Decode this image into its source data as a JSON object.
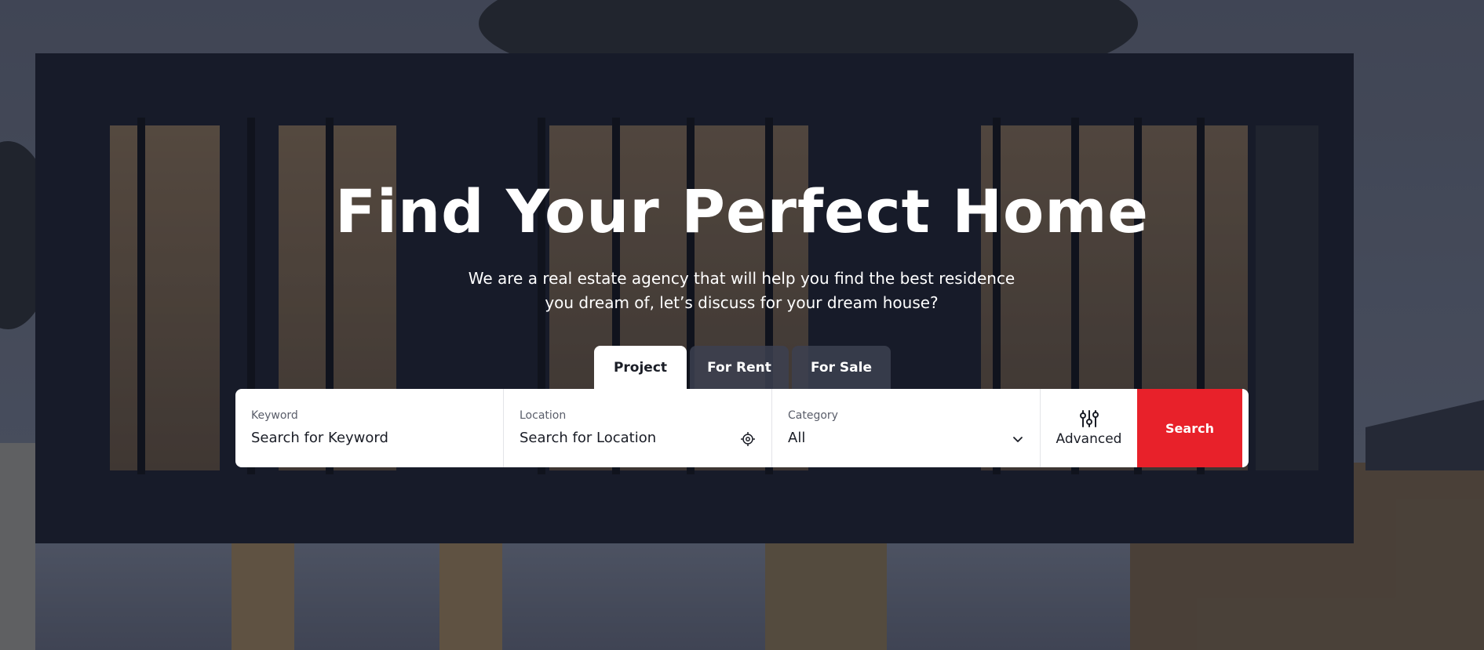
{
  "hero": {
    "title": "Find Your Perfect Home",
    "subtitle": "We are a real estate agency that will help you find the best residence you dream of, let’s discuss for your dream house?"
  },
  "tabs": [
    {
      "label": "Project",
      "active": true
    },
    {
      "label": "For Rent",
      "active": false
    },
    {
      "label": "For Sale",
      "active": false
    }
  ],
  "search": {
    "keyword": {
      "label": "Keyword",
      "placeholder": "Search for Keyword"
    },
    "location": {
      "label": "Location",
      "placeholder": "Search for Location",
      "icon": "location-target-icon"
    },
    "category": {
      "label": "Category",
      "value": "All",
      "icon": "chevron-down-icon"
    },
    "advanced": {
      "label": "Advanced",
      "icon": "sliders-icon"
    },
    "submit_label": "Search"
  },
  "colors": {
    "accent": "#e8212a",
    "panel": "#ffffff",
    "text_dark": "#1a1d26",
    "tab_inactive": "#3c4150"
  }
}
